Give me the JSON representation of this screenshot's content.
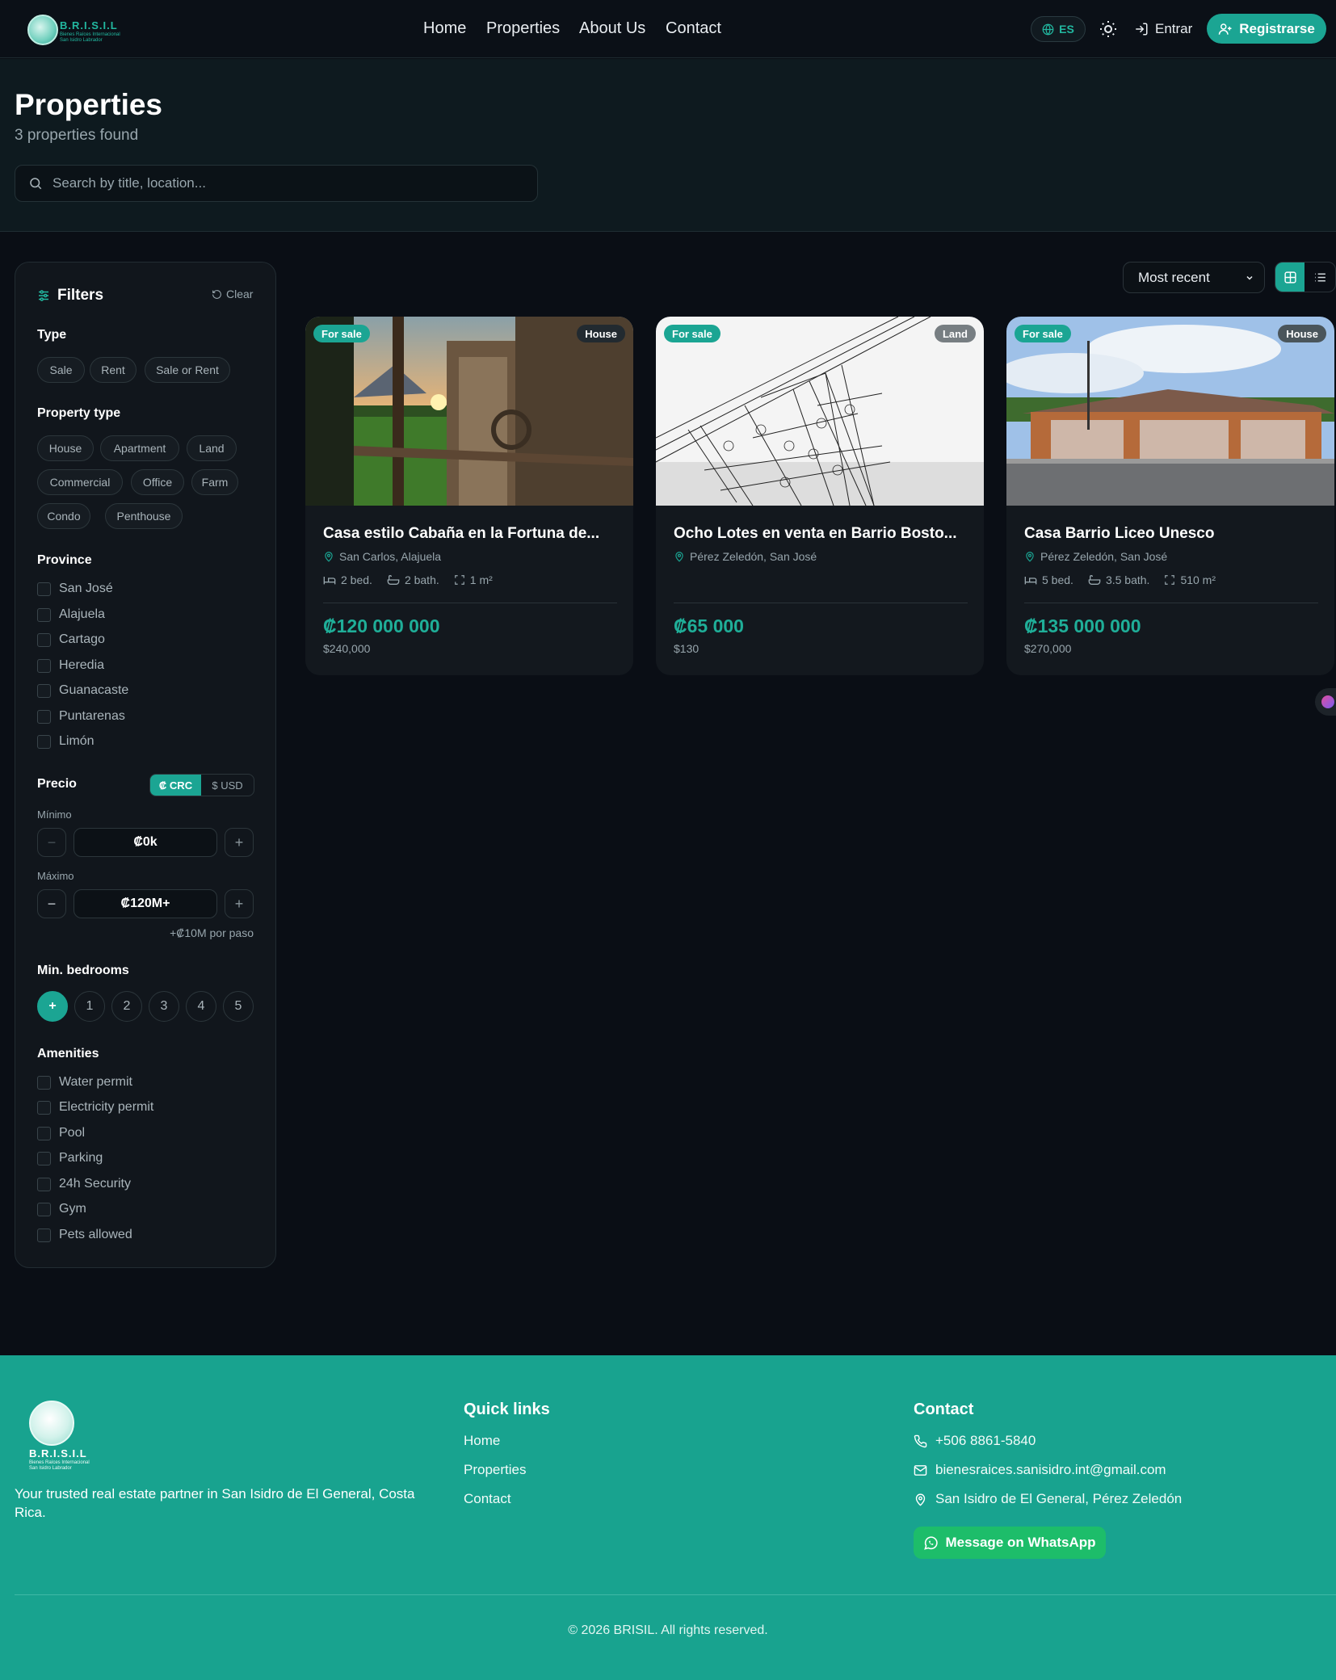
{
  "header": {
    "logo_text": "B.R.I.S.I.L",
    "logo_sub_line1": "Bienes Raíces Internacional",
    "logo_sub_line2": "San Isidro Labrador",
    "nav": [
      "Home",
      "Properties",
      "About Us",
      "Contact"
    ],
    "lang": "ES",
    "login": "Entrar",
    "register": "Registrarse"
  },
  "hero": {
    "title": "Properties",
    "count": "3 properties found",
    "search_placeholder": "Search by title, location..."
  },
  "filters": {
    "title": "Filters",
    "clear": "Clear",
    "type_label": "Type",
    "types": [
      "Sale",
      "Rent",
      "Sale or Rent"
    ],
    "ptype_label": "Property type",
    "ptypes": [
      "House",
      "Apartment",
      "Land",
      "Commercial",
      "Office",
      "Farm",
      "Condo",
      "Penthouse"
    ],
    "province_label": "Province",
    "provinces": [
      "San José",
      "Alajuela",
      "Cartago",
      "Heredia",
      "Guanacaste",
      "Puntarenas",
      "Limón"
    ],
    "price_label": "Precio",
    "currency_crc": "₡ CRC",
    "currency_usd": "$ USD",
    "min_label": "Mínimo",
    "min_value": "₡0k",
    "max_label": "Máximo",
    "max_value": "₡120M+",
    "step_note": "+₡10M por paso",
    "bedrooms_label": "Min. bedrooms",
    "bedrooms": [
      "+",
      "1",
      "2",
      "3",
      "4",
      "5"
    ],
    "amenities_label": "Amenities",
    "amenities": [
      "Water permit",
      "Electricity permit",
      "Pool",
      "Parking",
      "24h Security",
      "Gym",
      "Pets allowed"
    ]
  },
  "toolbar": {
    "sort": "Most recent",
    "sort_options": [
      "Most recent"
    ]
  },
  "cards": [
    {
      "status": "For sale",
      "kind": "House",
      "title": "Casa estilo Cabaña en la Fortuna de...",
      "location": "San Carlos, Alajuela",
      "beds": "2 bed.",
      "baths": "2 bath.",
      "area": "1 m²",
      "price": "₡120 000 000",
      "usd": "$240,000"
    },
    {
      "status": "For sale",
      "kind": "Land",
      "title": "Ocho Lotes en venta en Barrio Bosto...",
      "location": "Pérez Zeledón, San José",
      "beds": "",
      "baths": "",
      "area": "",
      "price": "₡65 000",
      "usd": "$130"
    },
    {
      "status": "For sale",
      "kind": "House",
      "title": "Casa Barrio Liceo Unesco",
      "location": "Pérez Zeledón, San José",
      "beds": "5 bed.",
      "baths": "3.5 bath.",
      "area": "510 m²",
      "price": "₡135 000 000",
      "usd": "$270,000"
    }
  ],
  "footer": {
    "tagline": "Your trusted real estate partner in San Isidro de El General, Costa Rica.",
    "quick_title": "Quick links",
    "quick_links": [
      "Home",
      "Properties",
      "Contact"
    ],
    "contact_title": "Contact",
    "phone": "+506 8861-5840",
    "email": "bienesraices.sanisidro.int@gmail.com",
    "address": "San Isidro de El General, Pérez Zeledón",
    "whatsapp": "Message on WhatsApp",
    "copyright": "© 2026 BRISIL. All rights reserved."
  },
  "colors": {
    "accent": "#1ba593",
    "bg": "#0a0e15",
    "footer": "#18a38f"
  }
}
